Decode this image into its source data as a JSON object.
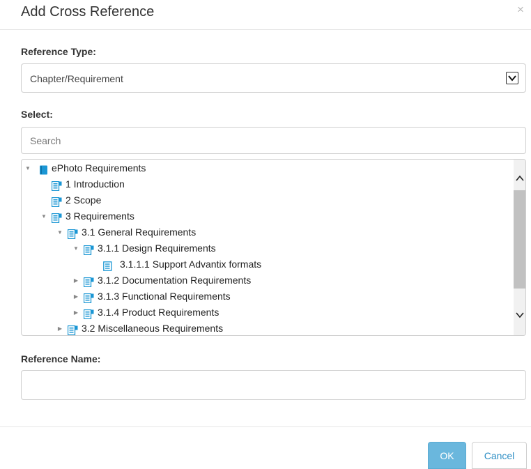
{
  "dialog": {
    "title": "Add Cross Reference",
    "close_label": "×"
  },
  "reference_type": {
    "label": "Reference Type:",
    "selected": "Chapter/Requirement"
  },
  "select_section": {
    "label": "Select:",
    "search_placeholder": "Search"
  },
  "tree": {
    "items": [
      {
        "label": "ePhoto Requirements",
        "level": 0,
        "toggle": "expanded",
        "icon": "book-icon"
      },
      {
        "label": "1 Introduction",
        "level": 1,
        "toggle": "none",
        "icon": "chapter-icon"
      },
      {
        "label": "2 Scope",
        "level": 1,
        "toggle": "none",
        "icon": "chapter-icon"
      },
      {
        "label": "3 Requirements",
        "level": 1,
        "toggle": "expanded",
        "icon": "chapter-icon"
      },
      {
        "label": "3.1 General Requirements",
        "level": 2,
        "toggle": "expanded",
        "icon": "chapter-icon"
      },
      {
        "label": "3.1.1 Design Requirements",
        "level": 3,
        "toggle": "expanded",
        "icon": "chapter-icon"
      },
      {
        "label": "3.1.1.1 Support Advantix formats",
        "level": 4,
        "toggle": "none",
        "icon": "requirement-icon"
      },
      {
        "label": "3.1.2 Documentation Requirements",
        "level": 3,
        "toggle": "collapsed",
        "icon": "chapter-icon"
      },
      {
        "label": "3.1.3 Functional Requirements",
        "level": 3,
        "toggle": "collapsed",
        "icon": "chapter-icon"
      },
      {
        "label": "3.1.4 Product Requirements",
        "level": 3,
        "toggle": "collapsed",
        "icon": "chapter-icon"
      },
      {
        "label": "3.2 Miscellaneous Requirements",
        "level": 2,
        "toggle": "collapsed",
        "icon": "chapter-icon"
      }
    ]
  },
  "reference_name": {
    "label": "Reference Name:",
    "value": ""
  },
  "footer": {
    "ok_label": "OK",
    "cancel_label": "Cancel"
  },
  "colors": {
    "accent": "#6ab7dd",
    "icon_blue": "#1a96d4",
    "link": "#2f8fc5"
  }
}
